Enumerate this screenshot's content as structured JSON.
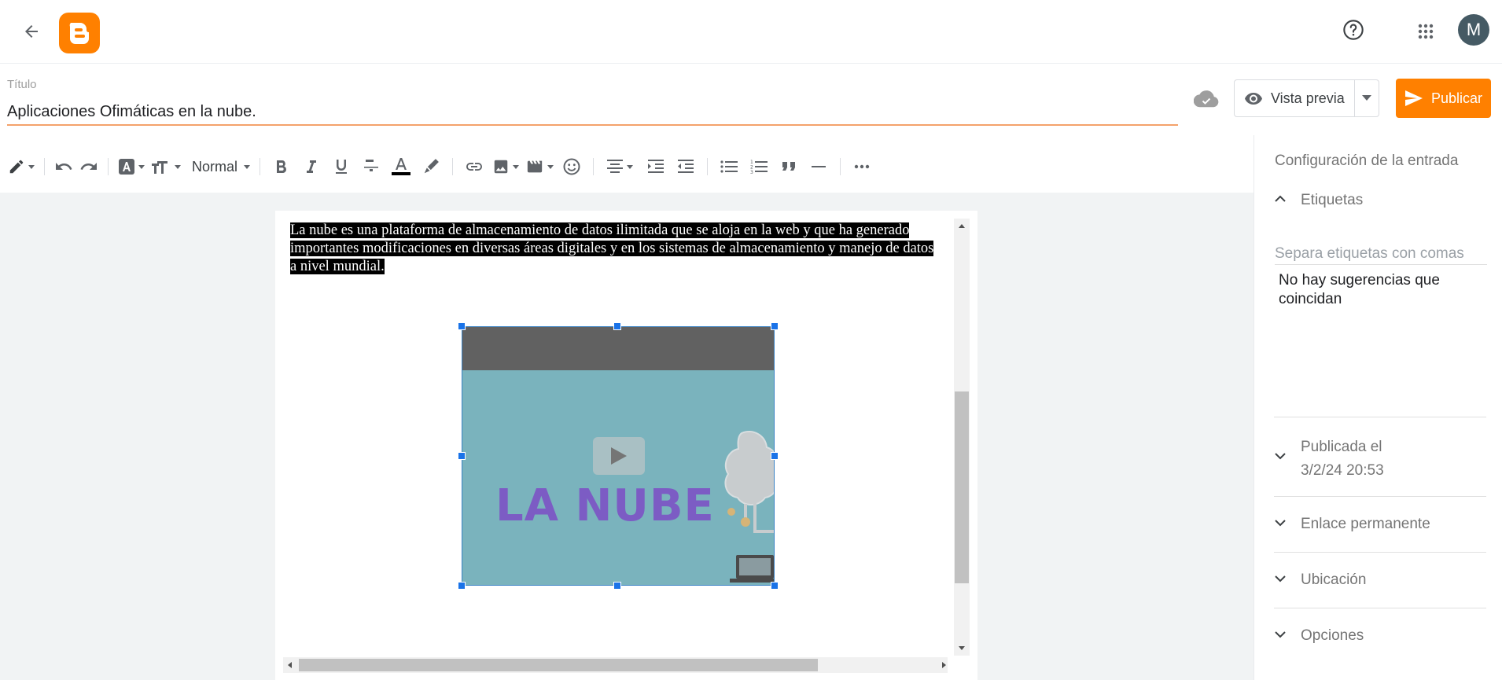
{
  "header": {
    "avatar_letter": "M",
    "brand_color": "#ff8000"
  },
  "post": {
    "title_label": "Título",
    "title_value": "Aplicaciones Ofimáticas en la nube.",
    "preview_label": "Vista previa",
    "publish_label": "Publicar"
  },
  "toolbar": {
    "paragraph_style": "Normal",
    "icons": [
      "pen-icon",
      "undo-icon",
      "redo-icon",
      "text-style-icon",
      "font-size-icon",
      "bold-icon",
      "italic-icon",
      "underline-icon",
      "strikethrough-icon",
      "text-color-icon",
      "highlight-icon",
      "link-icon",
      "image-icon",
      "video-icon",
      "emoji-icon",
      "align-icon",
      "indent-increase-icon",
      "indent-decrease-icon",
      "bulleted-list-icon",
      "numbered-list-icon",
      "quote-icon",
      "horizontal-rule-icon",
      "more-icon"
    ]
  },
  "editor": {
    "paragraph": "La nube es una plataforma de almacenamiento de datos ilimitada que se aloja en la web y que ha generado importantes modificaciones en diversas áreas digitales y en los sistemas de almacenamiento y manejo de datos a nivel mundial.",
    "video_title": "LA NUBE"
  },
  "sidebar": {
    "heading": "Configuración de la entrada",
    "labels_section": "Etiquetas",
    "labels_placeholder": "Separa etiquetas con comas",
    "no_suggestions": "No hay sugerencias que coincidan",
    "published_label": "Publicada el",
    "published_date": "3/2/24 20:53",
    "permalink": "Enlace permanente",
    "location": "Ubicación",
    "options": "Opciones"
  }
}
